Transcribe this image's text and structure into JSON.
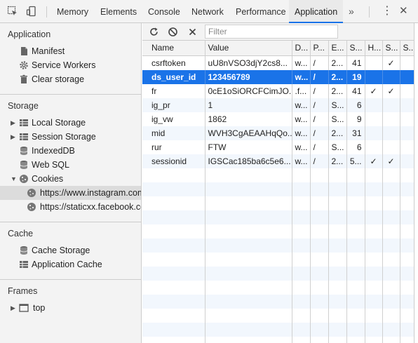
{
  "toolbar": {
    "inspect_icon": "element-picker-icon",
    "device_icon": "device-toolbar-icon",
    "tabs": [
      "Memory",
      "Elements",
      "Console",
      "Network",
      "Performance",
      "Application"
    ],
    "active_tab": "Application",
    "more_label": "»",
    "menu_label": "⋮",
    "close_label": "✕"
  },
  "sidebar": {
    "application": {
      "title": "Application",
      "items": [
        "Manifest",
        "Service Workers",
        "Clear storage"
      ]
    },
    "storage": {
      "title": "Storage",
      "local_storage": "Local Storage",
      "session_storage": "Session Storage",
      "indexeddb": "IndexedDB",
      "websql": "Web SQL",
      "cookies": "Cookies",
      "cookie_origins": [
        "https://www.instagram.com",
        "https://staticxx.facebook.com"
      ]
    },
    "cache": {
      "title": "Cache",
      "items": [
        "Cache Storage",
        "Application Cache"
      ]
    },
    "frames": {
      "title": "Frames",
      "top": "top"
    }
  },
  "cookies_toolbar": {
    "filter_placeholder": "Filter"
  },
  "cookies_table": {
    "columns": [
      "Name",
      "Value",
      "D...",
      "P...",
      "E...",
      "S...",
      "H...",
      "S...",
      "S..."
    ],
    "rows": [
      {
        "name": "csrftoken",
        "value": "uU8nVSO3djY2cs8...",
        "domain": "w...",
        "path": "/",
        "expires": "2...",
        "size": "41",
        "httponly": "",
        "secure": "✓",
        "samesite": ""
      },
      {
        "name": "ds_user_id",
        "value": "123456789",
        "domain": "w...",
        "path": "/",
        "expires": "2...",
        "size": "19",
        "httponly": "",
        "secure": "",
        "samesite": ""
      },
      {
        "name": "fr",
        "value": "0cE1oSiORCFCimJO...",
        "domain": ".f...",
        "path": "/",
        "expires": "2...",
        "size": "41",
        "httponly": "✓",
        "secure": "✓",
        "samesite": ""
      },
      {
        "name": "ig_pr",
        "value": "1",
        "domain": "w...",
        "path": "/",
        "expires": "S...",
        "size": "6",
        "httponly": "",
        "secure": "",
        "samesite": ""
      },
      {
        "name": "ig_vw",
        "value": "1862",
        "domain": "w...",
        "path": "/",
        "expires": "S...",
        "size": "9",
        "httponly": "",
        "secure": "",
        "samesite": ""
      },
      {
        "name": "mid",
        "value": "WVH3CgAEAAHqQo...",
        "domain": "w...",
        "path": "/",
        "expires": "2...",
        "size": "31",
        "httponly": "",
        "secure": "",
        "samesite": ""
      },
      {
        "name": "rur",
        "value": "FTW",
        "domain": "w...",
        "path": "/",
        "expires": "S...",
        "size": "6",
        "httponly": "",
        "secure": "",
        "samesite": ""
      },
      {
        "name": "sessionid",
        "value": "IGSCac185ba6c5e6...",
        "domain": "w...",
        "path": "/",
        "expires": "2...",
        "size": "5...",
        "httponly": "✓",
        "secure": "✓",
        "samesite": ""
      }
    ],
    "selected_row": 1,
    "empty_rows": 13
  },
  "colors": {
    "accent": "#1a73e8",
    "panel_bg": "#f3f3f3",
    "stripe": "#f2f7fd"
  }
}
